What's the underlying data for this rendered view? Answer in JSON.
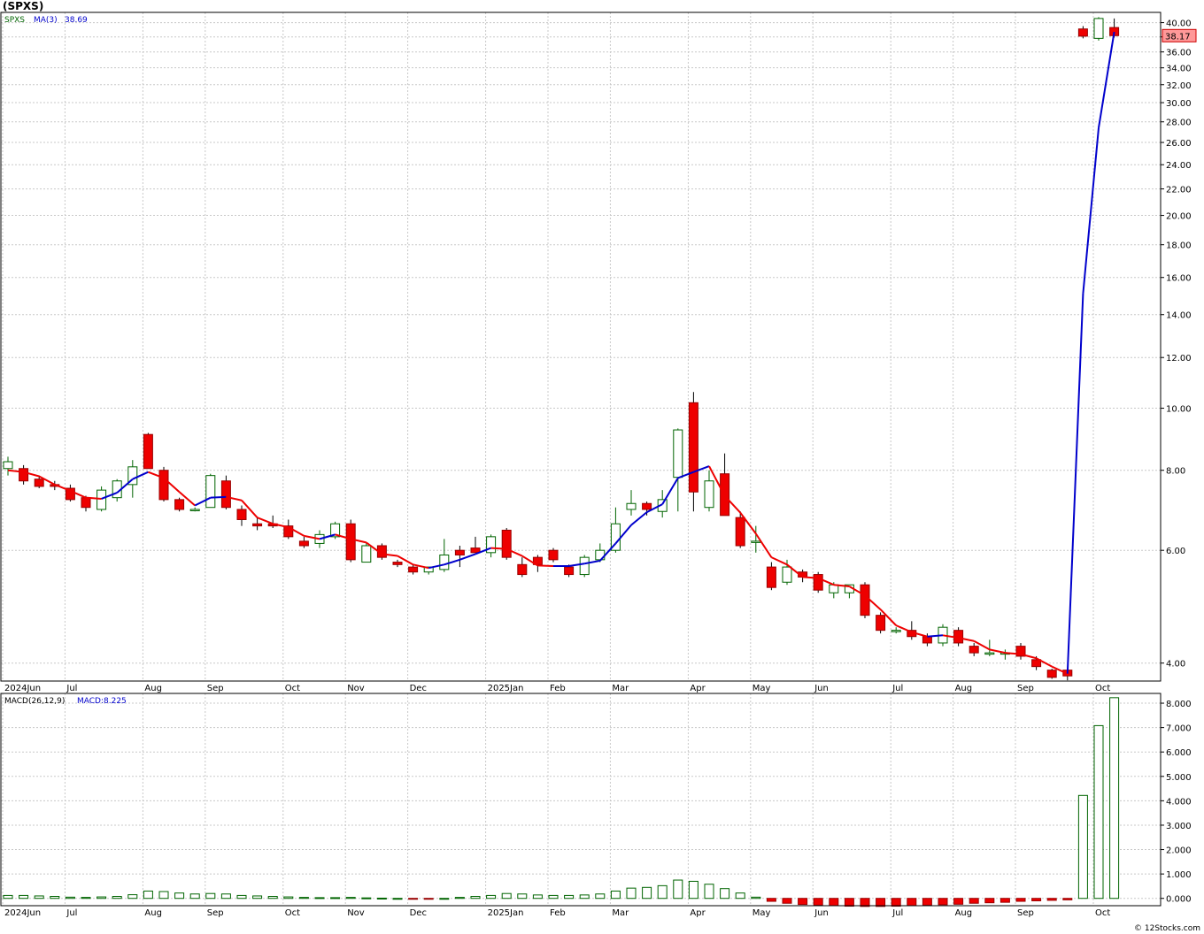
{
  "title": "(SPXS)",
  "footer": "© 12Stocks.com",
  "price_panel": {
    "legend_symbol": "SPXS",
    "legend_ma": "MA(3)",
    "legend_ma_value": "38.69",
    "last_price_label": "38.17",
    "colors": {
      "up": "#006400",
      "down": "#ee0000",
      "ma_up": "#0000cc",
      "ma_down": "#ee0000",
      "last_box": "#ff9999"
    }
  },
  "macd_panel": {
    "legend_name": "MACD(26,12,9)",
    "legend_value": "MACD:8.225",
    "colors": {
      "positive": "#006400",
      "negative": "#ee0000"
    }
  },
  "chart_data": [
    {
      "type": "candlestick",
      "scale": "log",
      "ylim": [
        3.75,
        41.5
      ],
      "yticks": [
        "4.00",
        "6.00",
        "8.00",
        "10.00",
        "12.00",
        "14.00",
        "16.00",
        "18.00",
        "20.00",
        "22.00",
        "24.00",
        "26.00",
        "28.00",
        "30.00",
        "32.00",
        "34.00",
        "36.00",
        "38.00",
        "40.00"
      ],
      "grid": true,
      "xticks": [
        {
          "label": "2024Jun",
          "i": 0
        },
        {
          "label": "Jul",
          "i": 4
        },
        {
          "label": "Aug",
          "i": 9
        },
        {
          "label": "Sep",
          "i": 13
        },
        {
          "label": "Oct",
          "i": 18
        },
        {
          "label": "Nov",
          "i": 22
        },
        {
          "label": "Dec",
          "i": 26
        },
        {
          "label": "2025Jan",
          "i": 31
        },
        {
          "label": "Feb",
          "i": 35
        },
        {
          "label": "Mar",
          "i": 39
        },
        {
          "label": "Apr",
          "i": 44
        },
        {
          "label": "May",
          "i": 48
        },
        {
          "label": "Jun",
          "i": 52
        },
        {
          "label": "Jul",
          "i": 57
        },
        {
          "label": "Aug",
          "i": 61
        },
        {
          "label": "Sep",
          "i": 65
        },
        {
          "label": "Oct",
          "i": 70
        }
      ],
      "candles": [
        {
          "o": 8.05,
          "h": 8.4,
          "l": 7.85,
          "c": 8.25
        },
        {
          "o": 8.05,
          "h": 8.15,
          "l": 7.6,
          "c": 7.7
        },
        {
          "o": 7.75,
          "h": 7.85,
          "l": 7.5,
          "c": 7.55
        },
        {
          "o": 7.6,
          "h": 7.7,
          "l": 7.45,
          "c": 7.55
        },
        {
          "o": 7.5,
          "h": 7.6,
          "l": 7.15,
          "c": 7.2
        },
        {
          "o": 7.25,
          "h": 7.3,
          "l": 6.9,
          "c": 7.0
        },
        {
          "o": 6.95,
          "h": 7.55,
          "l": 6.9,
          "c": 7.45
        },
        {
          "o": 7.25,
          "h": 7.75,
          "l": 7.15,
          "c": 7.7
        },
        {
          "o": 7.6,
          "h": 8.3,
          "l": 7.25,
          "c": 8.1
        },
        {
          "o": 9.1,
          "h": 9.15,
          "l": 8.05,
          "c": 8.05
        },
        {
          "o": 8.0,
          "h": 8.1,
          "l": 7.15,
          "c": 7.2
        },
        {
          "o": 7.2,
          "h": 7.25,
          "l": 6.9,
          "c": 6.95
        },
        {
          "o": 6.95,
          "h": 7.0,
          "l": 6.9,
          "c": 6.95
        },
        {
          "o": 7.0,
          "h": 7.9,
          "l": 7.0,
          "c": 7.85
        },
        {
          "o": 7.7,
          "h": 7.85,
          "l": 6.95,
          "c": 7.0
        },
        {
          "o": 6.95,
          "h": 7.05,
          "l": 6.55,
          "c": 6.7
        },
        {
          "o": 6.6,
          "h": 6.75,
          "l": 6.45,
          "c": 6.55
        },
        {
          "o": 6.6,
          "h": 6.8,
          "l": 6.5,
          "c": 6.55
        },
        {
          "o": 6.55,
          "h": 6.7,
          "l": 6.25,
          "c": 6.3
        },
        {
          "o": 6.2,
          "h": 6.3,
          "l": 6.05,
          "c": 6.1
        },
        {
          "o": 6.15,
          "h": 6.45,
          "l": 6.05,
          "c": 6.35
        },
        {
          "o": 6.3,
          "h": 6.65,
          "l": 6.25,
          "c": 6.6
        },
        {
          "o": 6.6,
          "h": 6.7,
          "l": 5.75,
          "c": 5.8
        },
        {
          "o": 5.75,
          "h": 6.15,
          "l": 5.75,
          "c": 6.1
        },
        {
          "o": 6.1,
          "h": 6.15,
          "l": 5.8,
          "c": 5.85
        },
        {
          "o": 5.75,
          "h": 5.8,
          "l": 5.65,
          "c": 5.7
        },
        {
          "o": 5.65,
          "h": 5.7,
          "l": 5.5,
          "c": 5.55
        },
        {
          "o": 5.55,
          "h": 5.65,
          "l": 5.5,
          "c": 5.65
        },
        {
          "o": 5.6,
          "h": 6.25,
          "l": 5.55,
          "c": 5.9
        },
        {
          "o": 6.0,
          "h": 6.1,
          "l": 5.65,
          "c": 5.9
        },
        {
          "o": 6.05,
          "h": 6.3,
          "l": 5.95,
          "c": 5.95
        },
        {
          "o": 5.95,
          "h": 6.35,
          "l": 5.85,
          "c": 6.3
        },
        {
          "o": 6.45,
          "h": 6.5,
          "l": 5.8,
          "c": 5.85
        },
        {
          "o": 5.7,
          "h": 5.85,
          "l": 5.45,
          "c": 5.5
        },
        {
          "o": 5.85,
          "h": 5.9,
          "l": 5.55,
          "c": 5.7
        },
        {
          "o": 6.0,
          "h": 6.05,
          "l": 5.75,
          "c": 5.8
        },
        {
          "o": 5.65,
          "h": 5.7,
          "l": 5.45,
          "c": 5.5
        },
        {
          "o": 5.5,
          "h": 5.9,
          "l": 5.45,
          "c": 5.85
        },
        {
          "o": 5.8,
          "h": 6.15,
          "l": 5.75,
          "c": 6.0
        },
        {
          "o": 6.0,
          "h": 7.0,
          "l": 5.95,
          "c": 6.6
        },
        {
          "o": 6.95,
          "h": 7.45,
          "l": 6.8,
          "c": 7.1
        },
        {
          "o": 7.1,
          "h": 7.15,
          "l": 6.8,
          "c": 6.95
        },
        {
          "o": 6.9,
          "h": 7.45,
          "l": 6.75,
          "c": 7.2
        },
        {
          "o": 7.8,
          "h": 9.3,
          "l": 6.9,
          "c": 9.25
        },
        {
          "o": 10.2,
          "h": 10.6,
          "l": 6.9,
          "c": 7.4
        },
        {
          "o": 7.0,
          "h": 8.0,
          "l": 6.9,
          "c": 7.7
        },
        {
          "o": 7.9,
          "h": 8.5,
          "l": 6.8,
          "c": 6.8
        },
        {
          "o": 6.75,
          "h": 6.9,
          "l": 6.05,
          "c": 6.1
        },
        {
          "o": 6.2,
          "h": 6.55,
          "l": 5.95,
          "c": 6.2
        },
        {
          "o": 5.65,
          "h": 5.75,
          "l": 5.2,
          "c": 5.25
        },
        {
          "o": 5.35,
          "h": 5.8,
          "l": 5.3,
          "c": 5.65
        },
        {
          "o": 5.55,
          "h": 5.6,
          "l": 5.35,
          "c": 5.45
        },
        {
          "o": 5.5,
          "h": 5.55,
          "l": 5.15,
          "c": 5.2
        },
        {
          "o": 5.15,
          "h": 5.35,
          "l": 5.05,
          "c": 5.3
        },
        {
          "o": 5.15,
          "h": 5.3,
          "l": 5.05,
          "c": 5.3
        },
        {
          "o": 5.3,
          "h": 5.35,
          "l": 4.7,
          "c": 4.75
        },
        {
          "o": 4.75,
          "h": 4.8,
          "l": 4.45,
          "c": 4.5
        },
        {
          "o": 4.5,
          "h": 4.55,
          "l": 4.45,
          "c": 4.5
        },
        {
          "o": 4.5,
          "h": 4.65,
          "l": 4.35,
          "c": 4.4
        },
        {
          "o": 4.4,
          "h": 4.45,
          "l": 4.25,
          "c": 4.3
        },
        {
          "o": 4.3,
          "h": 4.6,
          "l": 4.25,
          "c": 4.55
        },
        {
          "o": 4.5,
          "h": 4.55,
          "l": 4.25,
          "c": 4.3
        },
        {
          "o": 4.25,
          "h": 4.3,
          "l": 4.1,
          "c": 4.15
        },
        {
          "o": 4.15,
          "h": 4.35,
          "l": 4.1,
          "c": 4.15
        },
        {
          "o": 4.15,
          "h": 4.2,
          "l": 4.05,
          "c": 4.15
        },
        {
          "o": 4.25,
          "h": 4.3,
          "l": 4.05,
          "c": 4.1
        },
        {
          "o": 4.05,
          "h": 4.1,
          "l": 3.9,
          "c": 3.95
        },
        {
          "o": 3.9,
          "h": 3.92,
          "l": 3.78,
          "c": 3.8
        },
        {
          "o": 3.9,
          "h": 3.92,
          "l": 3.76,
          "c": 3.82
        },
        {
          "o": 39.1,
          "h": 39.5,
          "l": 37.8,
          "c": 38.1
        },
        {
          "o": 37.8,
          "h": 40.8,
          "l": 37.5,
          "c": 40.6
        },
        {
          "o": 39.3,
          "h": 40.6,
          "l": 37.9,
          "c": 38.17
        }
      ],
      "ma3": [
        8.0,
        7.95,
        7.83,
        7.6,
        7.43,
        7.25,
        7.22,
        7.38,
        7.75,
        7.95,
        7.78,
        7.4,
        7.05,
        7.25,
        7.27,
        7.18,
        6.75,
        6.6,
        6.52,
        6.32,
        6.25,
        6.35,
        6.25,
        6.17,
        5.92,
        5.88,
        5.7,
        5.63,
        5.7,
        5.8,
        5.92,
        6.05,
        6.03,
        5.88,
        5.68,
        5.67,
        5.67,
        5.72,
        5.78,
        6.15,
        6.57,
        6.88,
        7.08,
        7.78,
        7.95,
        8.12,
        7.3,
        6.87,
        6.37,
        5.85,
        5.7,
        5.45,
        5.43,
        5.3,
        5.27,
        5.1,
        4.85,
        4.58,
        4.47,
        4.4,
        4.42,
        4.38,
        4.33,
        4.2,
        4.15,
        4.13,
        4.07,
        3.95,
        3.85,
        15.1,
        27.4,
        38.69
      ],
      "last_price": 38.17
    },
    {
      "type": "bar",
      "name": "MACD(26,12,9)",
      "ylim": [
        -0.3,
        8.4
      ],
      "yticks": [
        "0.000",
        "1.000",
        "2.000",
        "3.000",
        "4.000",
        "5.000",
        "6.000",
        "7.000",
        "8.000"
      ],
      "grid": true,
      "values": [
        0.12,
        0.12,
        0.1,
        0.08,
        0.05,
        0.04,
        0.06,
        0.08,
        0.15,
        0.3,
        0.28,
        0.22,
        0.18,
        0.2,
        0.18,
        0.12,
        0.1,
        0.08,
        0.06,
        0.04,
        0.03,
        0.03,
        0.04,
        0.02,
        0.01,
        0.0,
        -0.02,
        -0.02,
        0.0,
        0.04,
        0.08,
        0.12,
        0.2,
        0.18,
        0.14,
        0.12,
        0.12,
        0.14,
        0.18,
        0.3,
        0.42,
        0.45,
        0.52,
        0.75,
        0.7,
        0.58,
        0.4,
        0.22,
        0.05,
        -0.12,
        -0.2,
        -0.25,
        -0.28,
        -0.3,
        -0.32,
        -0.33,
        -0.33,
        -0.32,
        -0.3,
        -0.28,
        -0.26,
        -0.24,
        -0.2,
        -0.18,
        -0.16,
        -0.12,
        -0.1,
        -0.08,
        -0.06,
        4.22,
        7.08,
        8.225
      ]
    }
  ]
}
